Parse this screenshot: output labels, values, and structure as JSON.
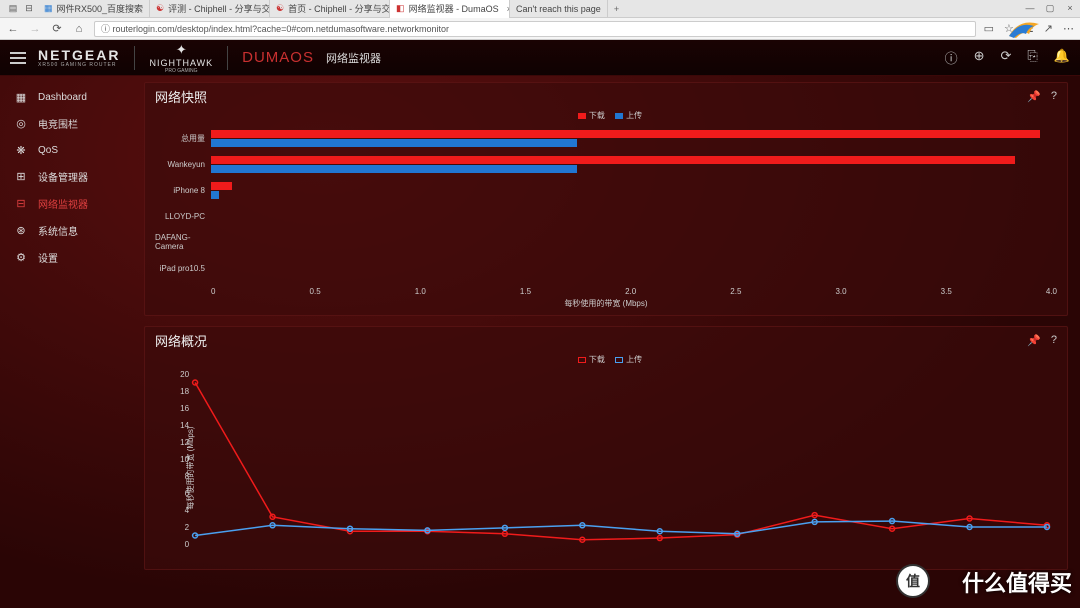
{
  "browser": {
    "tabs": [
      {
        "label": "网件RX500_百度搜索"
      },
      {
        "label": "评测 - Chiphell - 分享与交"
      },
      {
        "label": "首页 - Chiphell - 分享与交"
      },
      {
        "label": "网络监视器 - DumaOS",
        "active": true
      },
      {
        "label": "Can't reach this page"
      }
    ],
    "url": "routerlogin.com/desktop/index.html?cache=0#com.netdumasoftware.networkmonitor"
  },
  "header": {
    "brand_main": "NETGEAR",
    "brand_sub": "XR500 GAMING ROUTER",
    "nighthawk": "NIGHTHAWK",
    "nighthawk_sub": "PRO GAMING",
    "duma": "DUMAOS",
    "page": "网络监视器"
  },
  "sidebar": {
    "items": [
      {
        "icon": "dashboard",
        "label": "Dashboard"
      },
      {
        "icon": "target",
        "label": "电竞围栏"
      },
      {
        "icon": "flower",
        "label": "QoS"
      },
      {
        "icon": "devices",
        "label": "设备管理器"
      },
      {
        "icon": "monitor",
        "label": "网络监视器",
        "active": true
      },
      {
        "icon": "system",
        "label": "系统信息"
      },
      {
        "icon": "gear",
        "label": "设置"
      }
    ]
  },
  "panel_snapshot": {
    "title": "网络快照",
    "legend_dl": "下载",
    "legend_ul": "上传",
    "xaxis_title": "每秒使用的带宽 (Mbps)"
  },
  "panel_overview": {
    "title": "网络概况",
    "legend_dl": "下载",
    "legend_ul": "上传",
    "yaxis_title": "每秒使用的带宽 (Mbps)"
  },
  "chart_data": [
    {
      "type": "bar",
      "title": "网络快照",
      "xlabel": "每秒使用的带宽 (Mbps)",
      "xlim": [
        0,
        4.0
      ],
      "xticks": [
        0,
        0.5,
        1.0,
        1.5,
        2.0,
        2.5,
        3.0,
        3.5,
        4.0
      ],
      "categories": [
        "总用量",
        "Wankeyun",
        "iPhone 8",
        "LLOYD-PC",
        "DAFANG-Camera",
        "iPad pro10.5"
      ],
      "series": [
        {
          "name": "下载",
          "color": "#f01b1b",
          "values": [
            3.92,
            3.8,
            0.1,
            0,
            0,
            0
          ]
        },
        {
          "name": "上传",
          "color": "#2176d2",
          "values": [
            1.73,
            1.73,
            0.04,
            0,
            0,
            0
          ]
        }
      ]
    },
    {
      "type": "line",
      "title": "网络概况",
      "ylabel": "每秒使用的带宽 (Mbps)",
      "ylim": [
        0,
        20
      ],
      "yticks": [
        0,
        2,
        4,
        6,
        8,
        10,
        12,
        14,
        16,
        18,
        20
      ],
      "x": [
        0,
        1,
        2,
        3,
        4,
        5,
        6,
        7,
        8,
        9,
        10,
        11
      ],
      "series": [
        {
          "name": "下载",
          "color": "#f01b1b",
          "values": [
            19.0,
            3.2,
            1.5,
            1.5,
            1.2,
            0.5,
            0.7,
            1.1,
            3.4,
            1.8,
            3.0,
            2.2
          ]
        },
        {
          "name": "上传",
          "color": "#4aa0f0",
          "values": [
            1.0,
            2.2,
            1.8,
            1.6,
            1.9,
            2.2,
            1.5,
            1.2,
            2.6,
            2.7,
            2.0,
            2.0
          ]
        }
      ]
    }
  ],
  "watermark": {
    "badge": "值",
    "text": "什么值得买"
  }
}
